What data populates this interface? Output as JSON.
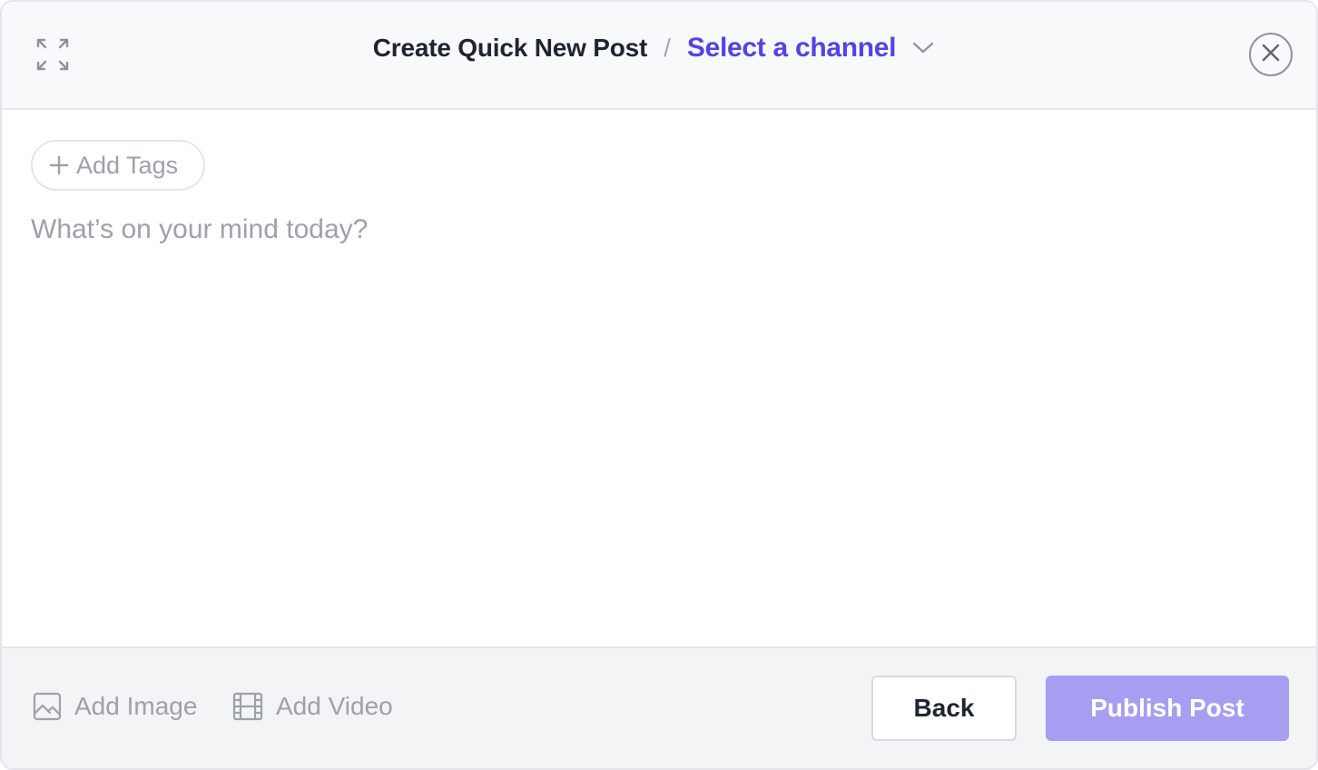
{
  "header": {
    "title": "Create Quick New Post",
    "separator": "/",
    "channel_select_label": "Select a channel"
  },
  "composer": {
    "add_tags_label": "Add Tags",
    "placeholder": "What’s on your mind today?",
    "value": ""
  },
  "footer": {
    "add_image_label": "Add Image",
    "add_video_label": "Add Video",
    "back_label": "Back",
    "publish_label": "Publish Post"
  },
  "colors": {
    "accent": "#5343e6",
    "publish_disabled": "#a69ef0",
    "muted_text": "#9ca1ab",
    "header_bg": "#f8f9fb",
    "footer_bg": "#f3f4f6"
  },
  "icons": {
    "expand": "expand-icon",
    "chevron": "chevron-down-icon",
    "close": "close-icon",
    "plus": "plus-icon",
    "image": "image-icon",
    "video": "video-icon"
  }
}
